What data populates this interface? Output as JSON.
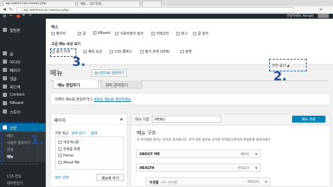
{
  "browser": {
    "tabs": [
      "wp-admin/nav-menus.php",
      "메뉴 ‹ 워드프레...",
      ""
    ],
    "url": "...wp-admin/nav-menus.php",
    "user": "안녕하세요, Kong님"
  },
  "sidebar": {
    "items": [
      "알림판",
      "글",
      "미디어",
      "페이지",
      "댓글",
      "피드백",
      "Contact",
      "KBoard",
      "스토어",
      "모양"
    ],
    "sub_items": [
      "테마",
      "사용자 정의하기",
      "위젯",
      "메뉴"
    ],
    "bottom_items": [
      "CSS 편집",
      "테마편집기"
    ]
  },
  "screen_options": {
    "boxes_heading": "박스",
    "boxes": [
      {
        "label": "페이지",
        "checked": true
      },
      {
        "label": "글",
        "checked": true
      },
      {
        "label": "KBoard",
        "checked": true
      },
      {
        "label": "사용자정의 링크",
        "checked": true
      },
      {
        "label": "카테고리",
        "checked": true
      },
      {
        "label": "태그",
        "checked": false
      },
      {
        "label": "글 형식",
        "checked": false
      }
    ],
    "advanced_heading": "고급 메뉴 속성 보기",
    "advanced": [
      {
        "label": "링크 타겟",
        "checked": true
      },
      {
        "label": "제목 속성",
        "checked": true
      },
      {
        "label": "CSS 클래스",
        "checked": false
      },
      {
        "label": "링크 관계 (XFN)",
        "checked": false
      },
      {
        "label": "설명",
        "checked": false
      }
    ]
  },
  "main": {
    "title": "메뉴",
    "live_preview": "실시간으로 관리하기",
    "screen_options_tab": "화면 옵션",
    "tabs": [
      "메뉴 편집하기",
      "위치 관리하기"
    ],
    "notice": "아래의 메뉴를 편집하거나 새로운 메뉴를 생성하세요.",
    "notice_link": "새로운 메뉴를 생성하세요"
  },
  "pages_box": {
    "heading": "페이지",
    "tabs": [
      "가장 최근",
      "모두 보기",
      "검색"
    ],
    "items": [
      {
        "label": "자유게시판",
        "checked": false
      },
      {
        "label": "전체글 목록",
        "checked": false
      },
      {
        "label": "Home",
        "checked": false
      },
      {
        "label": "About Me",
        "checked": false
      }
    ],
    "select_all": "모두 선택",
    "add_button": "메뉴에 추가"
  },
  "menu_editor": {
    "name_label": "메뉴 이름",
    "name_value": "MENU",
    "save_button": "메뉴 저장",
    "structure_heading": "메뉴 구조",
    "structure_help": "각 아이템을 원하는 순서로 끌어옵니다. 추가 설정 옵션을 보려면 아이템 오른쪽의 화살표를 클릭하세요.",
    "items": [
      {
        "title": "ABOUT ME",
        "type": "페이지"
      },
      {
        "title": "HEALTH",
        "type": "카테고리"
      }
    ],
    "sub_item": {
      "title": "식생활",
      "suffix": "서브 아이템",
      "type": "카테고리"
    }
  },
  "annotations": [
    "1.",
    "2.",
    "3."
  ],
  "colors": {
    "accent": "#0073aa",
    "annotation": "#1f4e9c",
    "admin_dark": "#23282d"
  }
}
